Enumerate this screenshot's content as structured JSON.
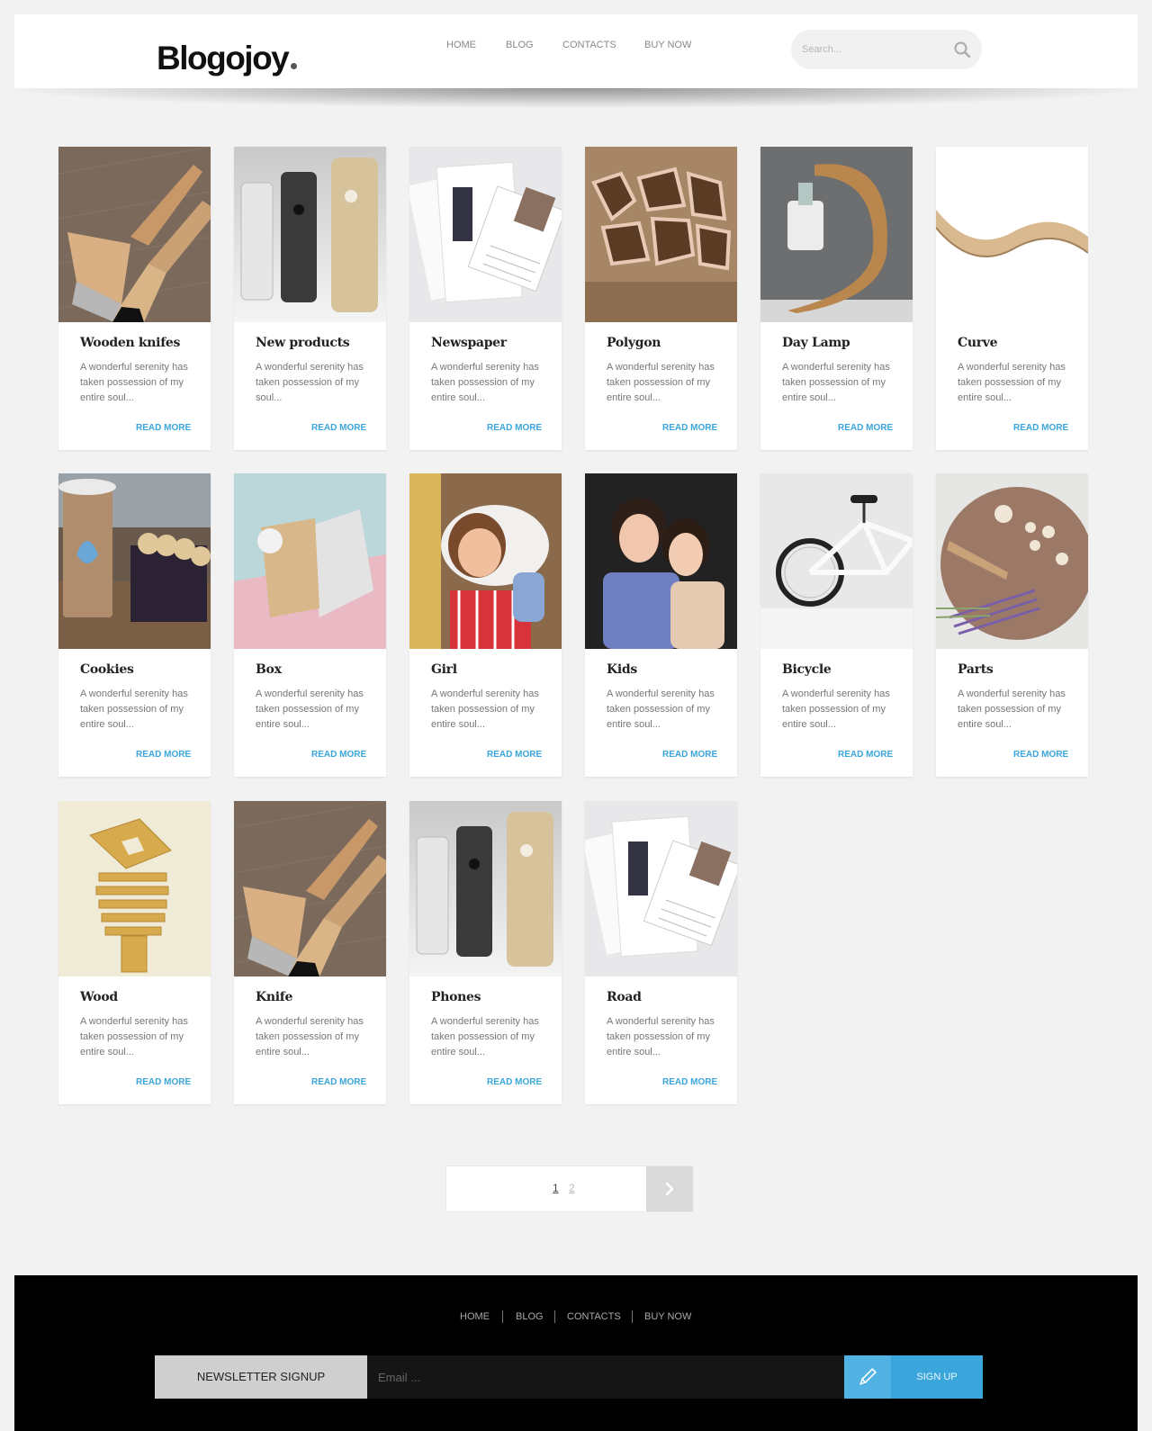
{
  "header": {
    "logo": "Blogojoy",
    "nav": [
      "HOME",
      "BLOG",
      "CONTACTS",
      "BUY NOW"
    ],
    "search_placeholder": "Search...",
    "search_icon": "search-icon"
  },
  "posts": [
    {
      "title": "Wooden knifes",
      "excerpt": "A wonderful serenity has taken possession of my entire soul...",
      "link": "READ MORE",
      "image": "wooden-knives"
    },
    {
      "title": "New products",
      "excerpt": "A wonderful serenity has taken possession of my soul...",
      "link": "READ MORE",
      "image": "phones"
    },
    {
      "title": "Newspaper",
      "excerpt": "A wonderful serenity has taken possession of my entire soul...",
      "link": "READ MORE",
      "image": "newspaper"
    },
    {
      "title": "Polygon",
      "excerpt": "A wonderful serenity has taken possession of my entire soul...",
      "link": "READ MORE",
      "image": "polygon-shelf"
    },
    {
      "title": "Day Lamp",
      "excerpt": "A wonderful serenity has taken possession of my entire soul...",
      "link": "READ MORE",
      "image": "day-lamp"
    },
    {
      "title": "Curve",
      "excerpt": "A wonderful serenity has taken possession of my entire soul...",
      "link": "READ MORE",
      "image": "curve"
    },
    {
      "title": "Cookies",
      "excerpt": "A wonderful serenity has taken possession of my entire soul...",
      "link": "READ MORE",
      "image": "cookies"
    },
    {
      "title": "Box",
      "excerpt": "A wonderful serenity has taken possession of my entire soul...",
      "link": "READ MORE",
      "image": "box"
    },
    {
      "title": "Girl",
      "excerpt": "A wonderful serenity has taken possession of my entire soul...",
      "link": "READ MORE",
      "image": "girl"
    },
    {
      "title": "Kids",
      "excerpt": "A wonderful serenity has taken possession of my entire soul...",
      "link": "READ MORE",
      "image": "kids"
    },
    {
      "title": "Bicycle",
      "excerpt": "A wonderful serenity has taken possession of my entire soul...",
      "link": "READ MORE",
      "image": "bicycle"
    },
    {
      "title": "Parts",
      "excerpt": "A wonderful serenity has taken possession of my entire soul...",
      "link": "READ MORE",
      "image": "parts"
    },
    {
      "title": "Wood",
      "excerpt": "A wonderful serenity has taken possession of my entire soul...",
      "link": "READ MORE",
      "image": "wood-stack"
    },
    {
      "title": "Knife",
      "excerpt": "A wonderful serenity has taken possession of my entire soul...",
      "link": "READ MORE",
      "image": "wooden-knives"
    },
    {
      "title": "Phones",
      "excerpt": "A wonderful serenity has taken possession of my entire soul...",
      "link": "READ MORE",
      "image": "phones"
    },
    {
      "title": "Road",
      "excerpt": "A wonderful serenity has taken possession of my entire soul...",
      "link": "READ MORE",
      "image": "newspaper"
    }
  ],
  "pagination": {
    "pages": [
      "1",
      "2"
    ],
    "current": "1",
    "next_icon": "chevron-right-icon"
  },
  "footer": {
    "nav": [
      "HOME",
      "BLOG",
      "CONTACTS",
      "BUY NOW"
    ],
    "newsletter_label": "NEWSLETTER SIGNUP",
    "email_placeholder": "Email ...",
    "pen_icon": "pencil-icon",
    "signup_label": "SIGN UP"
  },
  "colors": {
    "accent": "#3ba6dc",
    "page_bg": "#f2f2f2",
    "footer_bg": "#000000"
  }
}
